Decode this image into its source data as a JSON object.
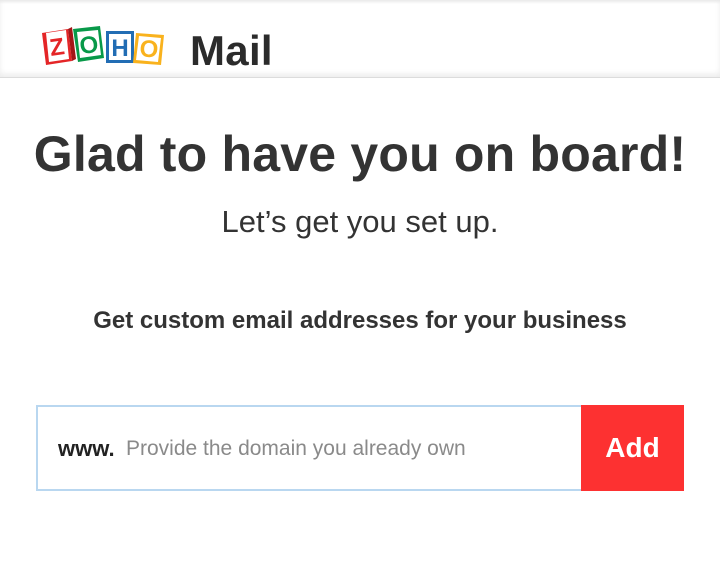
{
  "header": {
    "logo_text": "ZOHO",
    "logo_letters": [
      "Z",
      "O",
      "H",
      "O"
    ],
    "logo_colors": [
      "#e42527",
      "#089949",
      "#226db4",
      "#f9b21d"
    ],
    "product_name": "Mail"
  },
  "main": {
    "headline": "Glad to have you on board!",
    "subhead": "Let’s get you set up.",
    "section_title": "Get custom email addresses for your business",
    "domain_form": {
      "prefix": "www.",
      "placeholder": "Provide the domain you already own",
      "value": "",
      "add_label": "Add"
    }
  },
  "colors": {
    "add_button": "#fd3131",
    "input_border": "#b9d7f0",
    "text": "#333333"
  }
}
